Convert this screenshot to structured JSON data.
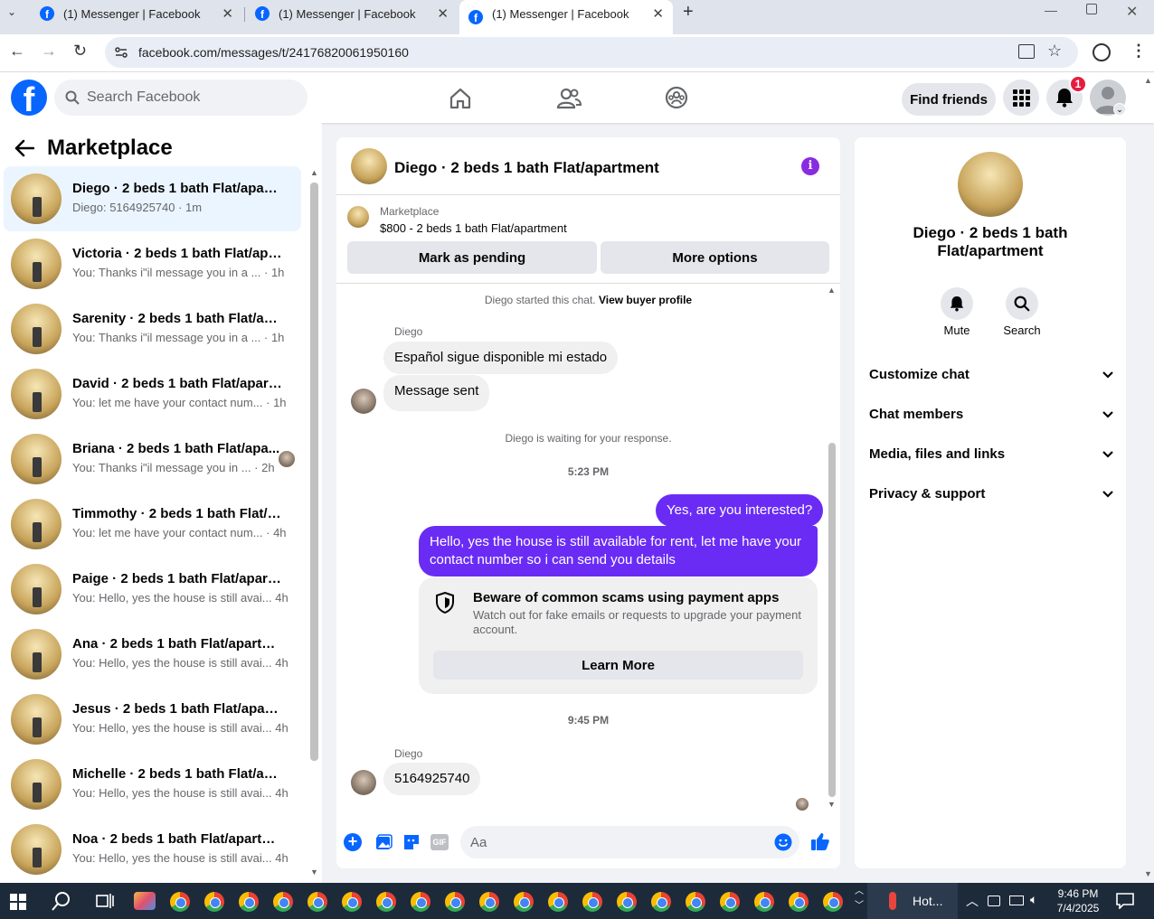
{
  "browser": {
    "tabs": [
      {
        "title": "(1) Messenger | Facebook"
      },
      {
        "title": "(1) Messenger | Facebook"
      },
      {
        "title": "(1) Messenger | Facebook"
      }
    ],
    "url": "facebook.com/messages/t/24176820061950160"
  },
  "header": {
    "search_placeholder": "Search Facebook",
    "find_friends": "Find friends",
    "notification_count": "1"
  },
  "sidebar": {
    "title": "Marketplace",
    "conversations": [
      {
        "name": "Diego · 2 beds 1 bath Flat/apart...",
        "preview": "Diego: 5164925740 · 1m"
      },
      {
        "name": "Victoria · 2 beds 1 bath Flat/apar...",
        "preview": "You: Thanks i\"il message you in a ...  · 1h"
      },
      {
        "name": "Sarenity · 2 beds 1 bath Flat/apa...",
        "preview": "You: Thanks i\"il message you in a ...  · 1h"
      },
      {
        "name": "David · 2 beds 1 bath Flat/apart...",
        "preview": "You: let me have your contact num... · 1h"
      },
      {
        "name": "Briana · 2 beds 1 bath Flat/apa...",
        "preview": "You: Thanks i\"il message you in ...  · 2h"
      },
      {
        "name": "Timmothy · 2 beds 1 bath Flat/a...",
        "preview": "You: let me have your contact num... · 4h"
      },
      {
        "name": "Paige · 2 beds 1 bath Flat/apart...",
        "preview": "You: Hello, yes the house is still avai... 4h"
      },
      {
        "name": "Ana · 2 beds 1 bath Flat/apartm...",
        "preview": "You: Hello, yes the house is still avai... 4h"
      },
      {
        "name": "Jesus · 2 beds 1 bath Flat/apart...",
        "preview": "You: Hello, yes the house is still avai... 4h"
      },
      {
        "name": "Michelle · 2 beds 1 bath Flat/apa...",
        "preview": "You: Hello, yes the house is still avai... 4h"
      },
      {
        "name": "Noa · 2 beds 1 bath Flat/apartm...",
        "preview": "You: Hello, yes the house is still avai... 4h"
      }
    ]
  },
  "chat": {
    "title": "Diego · 2 beds 1 bath Flat/apartment",
    "listing_label": "Marketplace",
    "listing_title": "$800 - 2 beds 1 bath Flat/apartment",
    "mark_pending": "Mark as pending",
    "more_options": "More options",
    "started_text": "Diego started this chat.",
    "view_buyer": "View buyer profile",
    "sender": "Diego",
    "msg1": "Español sigue disponible mi estado",
    "msg2": "Message sent",
    "waiting": "Diego is waiting for your response.",
    "time1": "5:23 PM",
    "out1": "Yes, are you interested?",
    "out2": "Hello, yes the house is still available for rent, let me have your contact number so i can send you details",
    "scam_title": "Beware of common scams using payment apps",
    "scam_body": "Watch out for fake emails or requests to upgrade your payment account.",
    "learn_more": "Learn More",
    "time2": "9:45 PM",
    "msg3": "5164925740",
    "input_placeholder": "Aa"
  },
  "details": {
    "name": "Diego · 2 beds 1 bath Flat/apartment",
    "mute": "Mute",
    "search": "Search",
    "sections": [
      "Customize chat",
      "Chat members",
      "Media, files and links",
      "Privacy & support"
    ]
  },
  "taskbar": {
    "weather": "Hot...",
    "time": "9:46 PM",
    "date": "7/4/2025"
  },
  "colors": {
    "brand": "#0866ff",
    "accent": "#6a2cf5",
    "badge": "#e41e3f"
  }
}
